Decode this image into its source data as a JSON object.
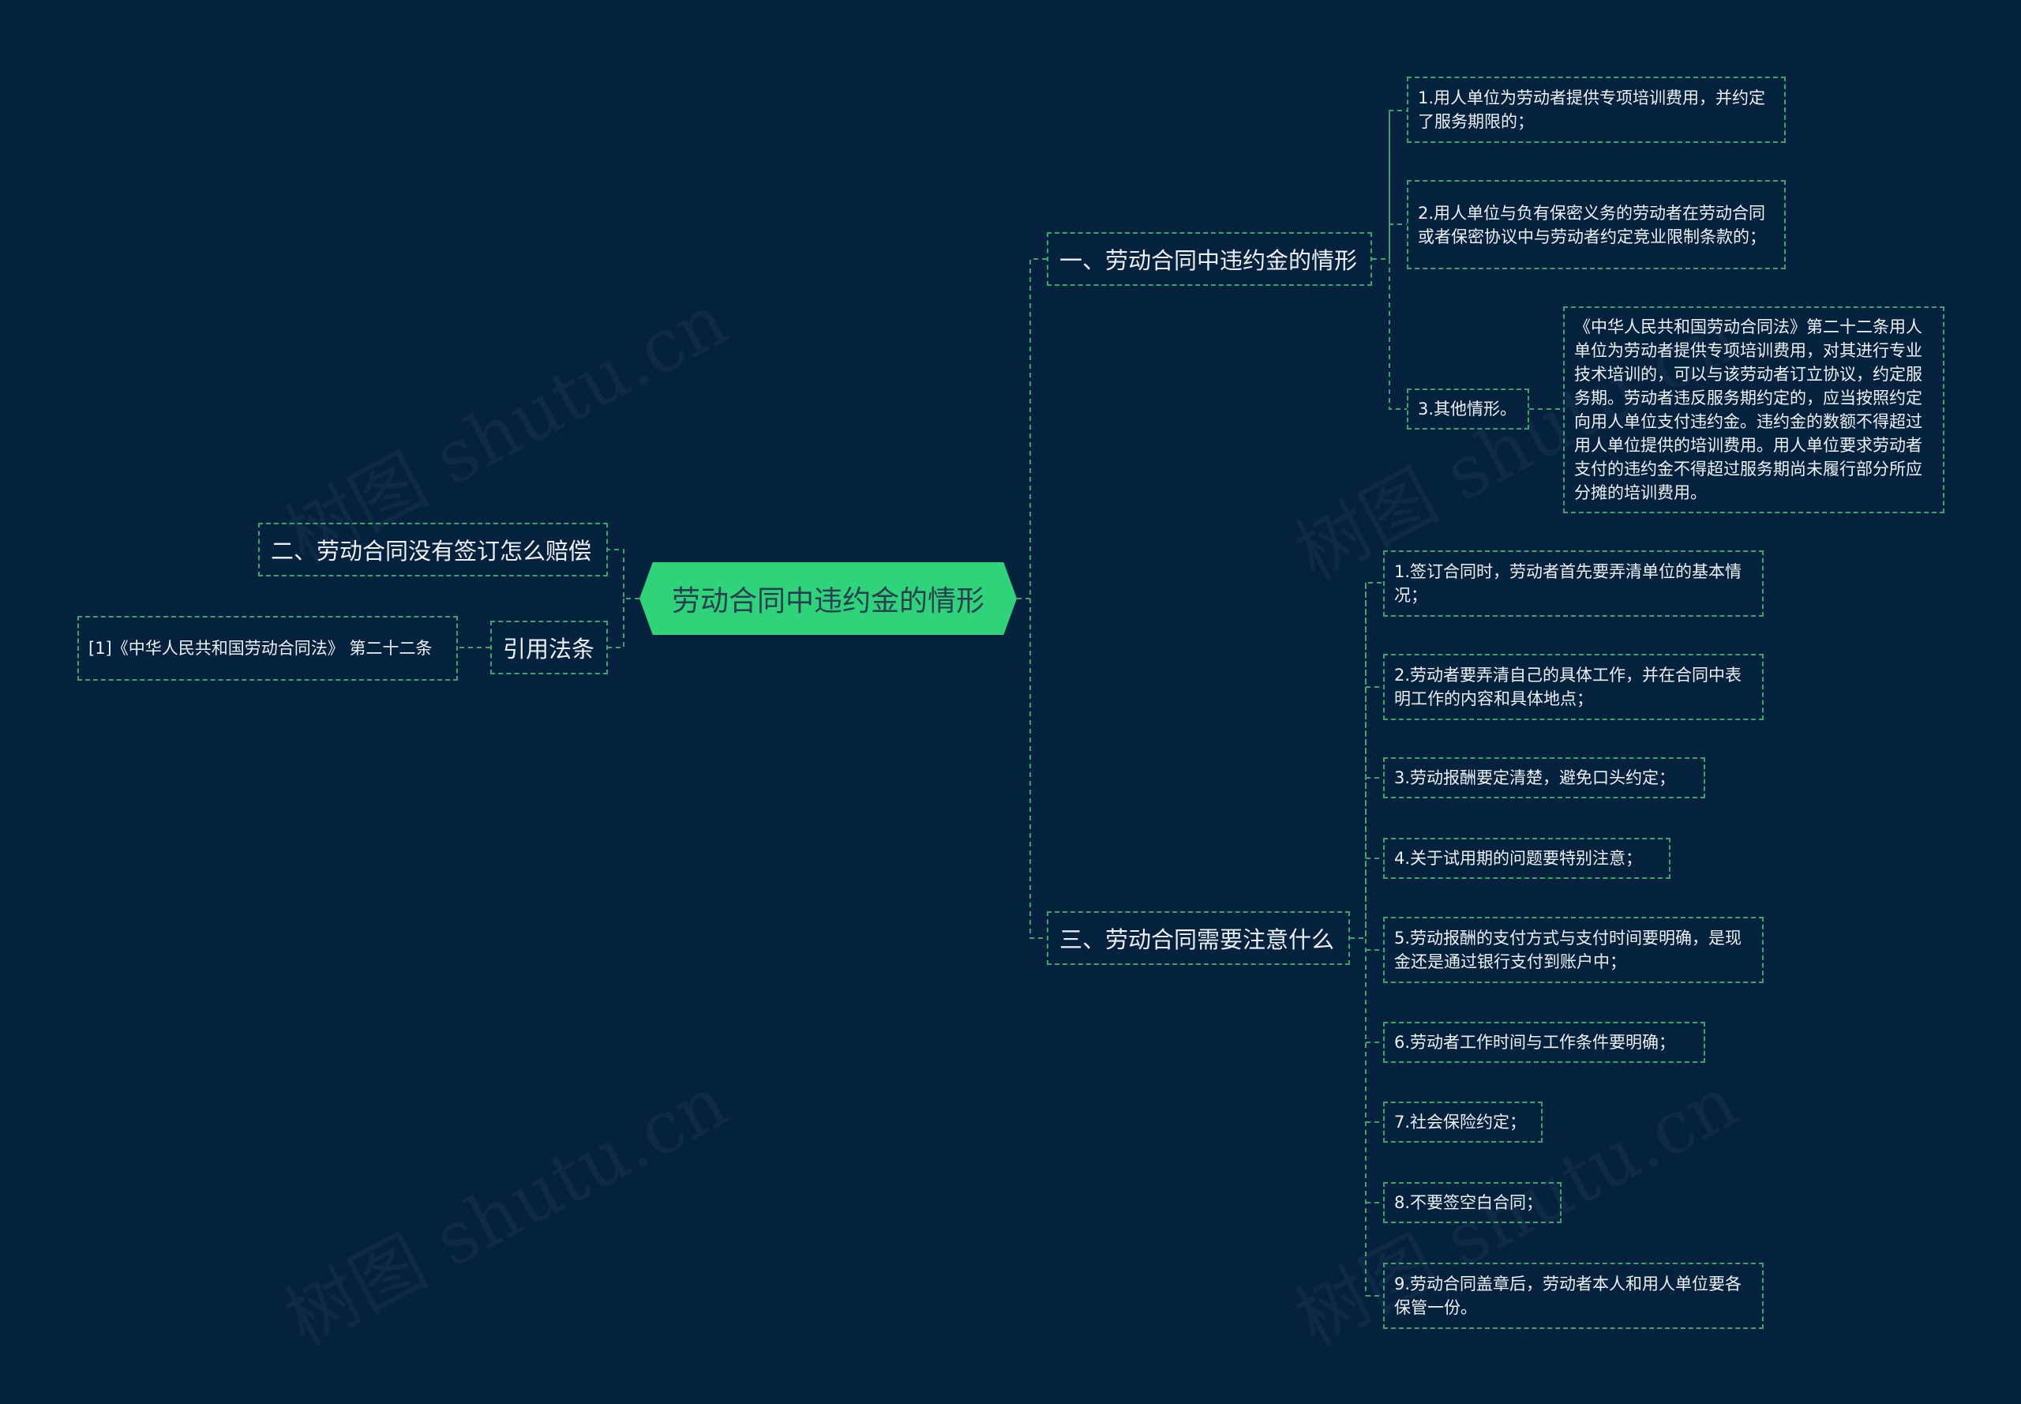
{
  "central": "劳动合同中违约金的情形",
  "watermark": "树图 shutu.cn",
  "colors": {
    "background": "#04213e",
    "root_fill": "#2fd37a",
    "line": "#3aa66a",
    "text": "#eef2f5"
  },
  "left": {
    "branch2": "二、劳动合同没有签订怎么赔偿",
    "cite": {
      "label": "引用法条",
      "ref": "[1]《中华人民共和国劳动合同法》 第二十二条"
    }
  },
  "right": {
    "branch1": {
      "label": "一、劳动合同中违约金的情形",
      "items": [
        "1.用人单位为劳动者提供专项培训费用，并约定了服务期限的；",
        "2.用人单位与负有保密义务的劳动者在劳动合同或者保密协议中与劳动者约定竞业限制条款的；",
        "3.其他情形。"
      ],
      "detail": "《中华人民共和国劳动合同法》第二十二条用人单位为劳动者提供专项培训费用，对其进行专业技术培训的，可以与该劳动者订立协议，约定服务期。劳动者违反服务期约定的，应当按照约定向用人单位支付违约金。违约金的数额不得超过用人单位提供的培训费用。用人单位要求劳动者支付的违约金不得超过服务期尚未履行部分所应分摊的培训费用。"
    },
    "branch3": {
      "label": "三、劳动合同需要注意什么",
      "items": [
        "1.签订合同时，劳动者首先要弄清单位的基本情况；",
        "2.劳动者要弄清自己的具体工作，并在合同中表明工作的内容和具体地点；",
        "3.劳动报酬要定清楚，避免口头约定；",
        "4.关于试用期的问题要特别注意；",
        "5.劳动报酬的支付方式与支付时间要明确，是现金还是通过银行支付到账户中；",
        "6.劳动者工作时间与工作条件要明确；",
        "7.社会保险约定；",
        "8.不要签空白合同；",
        "9.劳动合同盖章后，劳动者本人和用人单位要各保管一份。"
      ]
    }
  }
}
